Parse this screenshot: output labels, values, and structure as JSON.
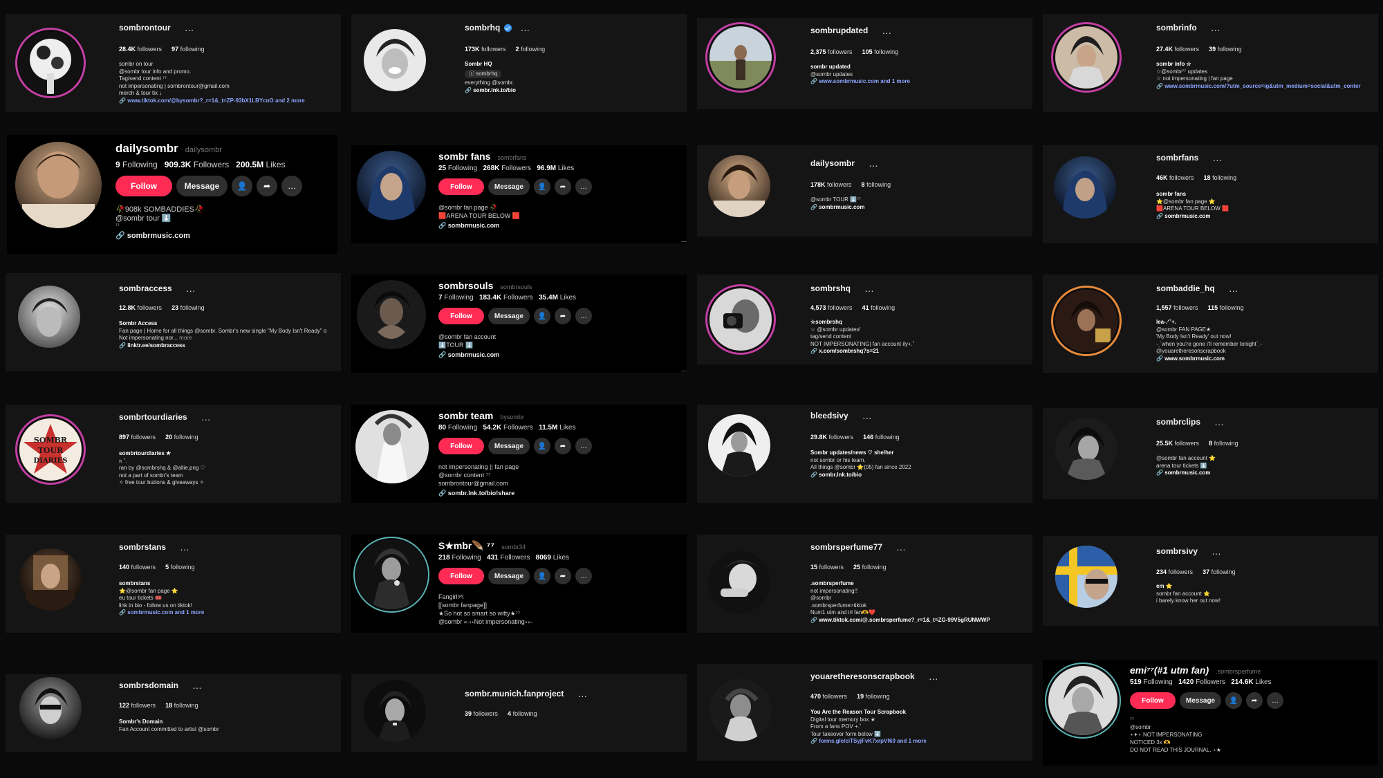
{
  "icons": {
    "more": "…",
    "add_user": "add-user-icon",
    "share": "share-icon",
    "link": "link-icon"
  },
  "colors": {
    "follow": "#fe2c55",
    "link": "#8da6ff",
    "story_ring": "#c23fa3",
    "verified": "#3897f0"
  },
  "ig": [
    {
      "user": "sombrontour",
      "followers": "28.4K",
      "following": "97",
      "bio": [
        "sombr on tour",
        "@sombr tour info and promo.",
        "Tag/send content ⁷⁷",
        "not impersonating | sombrontour@gmail.com",
        "merch & tour tix ↓"
      ],
      "link": "www.tiktok.com/@bysombr?_r=1&_t=ZP-93bX1LBYcnO and 2 more"
    },
    {
      "user": "sombrhq",
      "followers": "173K",
      "following": "2",
      "bio": [
        "Sombr HQ",
        "ⓢ sombrhq",
        "everything @sombr."
      ],
      "link": "sombr.lnk.to/bio"
    },
    {
      "user": "sombrupdated",
      "followers": "2,375",
      "following": "105",
      "bio": [
        "sombr updated",
        "@sombr updates"
      ],
      "link": "www.sombrmusic.com and 1 more"
    },
    {
      "user": "sombrinfo",
      "followers": "27.4K",
      "following": "39",
      "bio": [
        "sombr info ☆",
        "☆@sombr⁷⁷ updates",
        "☆ not impersonating | fan page"
      ],
      "link": "www.sombrmusic.com/?utm_source=ig&utm_medium=social&utm_conter"
    },
    {
      "user": "dailysombr",
      "followers": "178K",
      "following": "8",
      "bio": [
        "@sombr TOUR ⬇️⁷⁷"
      ],
      "link": "sombrmusic.com"
    },
    {
      "user": "sombrfans",
      "followers": "46K",
      "following": "18",
      "bio": [
        "sombr fans",
        "⭐@sombr fan page ⭐",
        "🟥ARENA TOUR BELOW 🟥"
      ],
      "link": "sombrmusic.com"
    },
    {
      "user": "sombraccess",
      "followers": "12.8K",
      "following": "23",
      "bio": [
        "Sombr Access",
        "Fan page | Home for all things @sombr. Sombr's new single \"My Body Isn't Ready\" o",
        "Not impersonating nor..."
      ],
      "more": "more",
      "link": "linktr.ee/sombraccess"
    },
    {
      "user": "sombrshq",
      "followers": "4,573",
      "following": "41",
      "bio": [
        "☆sombrshq",
        "☆ @sombr updates!",
        "tag/send content",
        "NOT IMPERSONATING| fan account ily+.˚"
      ],
      "link": "x.com/sombrshq?s=21"
    },
    {
      "user": "sombaddie_hq",
      "followers": "1,557",
      "following": "115",
      "bio": [
        "lea-.ᐟ˚+.",
        "@sombr FAN PAGE★",
        "'My Body Isn't Ready' out now!",
        "-ˏˋwhen you're gone i'll remember tonightˊˎ-",
        "@youaretheresonscrapbook"
      ],
      "link": "www.sombrmusic.com"
    },
    {
      "user": "sombrtourdiaries",
      "followers": "897",
      "following": "20",
      "bio": [
        "sombrtourdiaries ★",
        "೫ ˚.",
        "ran by @sombrshq & @allie.png ♡",
        "not a part of sombr's team",
        "✧ free tour buttons & giveaways ✧"
      ],
      "link": ""
    },
    {
      "user": "bleedsivy",
      "followers": "29.8K",
      "following": "146",
      "bio": [
        "Sombr updates/news ♡  she/her",
        "not sombr or his team.",
        "All things @sombr ⭐(05) fan since 2022"
      ],
      "link": "sombr.lnk.to/bio"
    },
    {
      "user": "sombrclips",
      "followers": "25.5K",
      "following": "8",
      "bio": [
        "@sombr fan account ⭐",
        "arena tour tickets ⬇️"
      ],
      "link": "sombrmusic.com"
    },
    {
      "user": "sombrstans",
      "followers": "140",
      "following": "5",
      "bio": [
        "sombrstans",
        "⭐@sombr fan page ⭐",
        "eu tour tickets 🎟️",
        "link in bio - follow us on tiktok!"
      ],
      "link": "sombrmusic.com and 1 more"
    },
    {
      "user": "sombrsperfume77",
      "followers": "15",
      "following": "25",
      "bio": [
        ".sombrsperfume",
        "not impersonating!!",
        "@sombr",
        ".sombrsperfume>tiktok",
        "Num1 utm and irl fan🫶❤️"
      ],
      "link": "www.tiktok.com/@.sombrsperfume?_r=1&_t=ZG-99V5gRUNWWP"
    },
    {
      "user": "sombrsivy",
      "followers": "234",
      "following": "37",
      "bio": [
        "em ⭐",
        "sombr fan account ⭐",
        "i barely know her out now!"
      ],
      "link": ""
    },
    {
      "user": "sombrsdomain",
      "followers": "122",
      "following": "18",
      "bio": [
        "Sombr's Domain",
        "Fan Account committed to artist @sombr"
      ],
      "link": ""
    },
    {
      "user": "sombr.munich.fanproject",
      "followers": "39",
      "following": "4",
      "bio": [],
      "link": ""
    },
    {
      "user": "youaretheresonscrapbook",
      "followers": "470",
      "following": "19",
      "bio": [
        "You Are the Reason Tour Scrapbook",
        "Digital tour memory box ★",
        "From a fans POV +.˚",
        "Tour takeover form below ⬇️"
      ],
      "link": "forms.gle/ciTSyjFvK7xrpVf69 and 1 more"
    }
  ],
  "tt": [
    {
      "name": "dailysombr",
      "handle": "dailysombr",
      "following": "9",
      "followers": "909.3K",
      "likes": "200.5M",
      "bio": [
        "🥀908k SOMBADDIES🥀",
        "@sombr tour ⬇️",
        "⁷⁷"
      ],
      "link": "sombrmusic.com"
    },
    {
      "name": "sombr fans",
      "handle": "sombrfans",
      "following": "25",
      "followers": "268K",
      "likes": "96.9M",
      "bio": [
        "@sombr fan page 🥀",
        "🟥ARENA TOUR BELOW 🟥"
      ],
      "link": "sombrmusic.com"
    },
    {
      "name": "sombrsouls",
      "handle": "sombrsouls",
      "following": "7",
      "followers": "183.4K",
      "likes": "35.4M",
      "bio": [
        "@sombr fan account",
        "⬇️TOUR ⬇️"
      ],
      "link": "sombrmusic.com"
    },
    {
      "name": "sombr team",
      "handle": "bysombr",
      "following": "80",
      "followers": "54.2K",
      "likes": "11.5M",
      "bio": [
        "not impersonating || fan page",
        "@sombr content ⁷⁷",
        "sombrontour@gmail.com"
      ],
      "link": "sombr.lnk.to/bio!share"
    },
    {
      "name": "S★mbr🪶 ⁷⁷",
      "handle": "sombr34",
      "following": "218",
      "followers": "431",
      "likes": "8069",
      "bio": [
        "Fangirl୨ৎ",
        "[[sombr fanpage]]",
        "★So hot so smart so witty★⁷⁷",
        "@sombr ⬷⋆Not impersonating⋆⬸"
      ],
      "link": ""
    },
    {
      "name": "emi⁷⁷(#1 utm fan)",
      "handle": ".sombrsperfume",
      "following": "519",
      "followers": "1420",
      "likes": "214.6K",
      "bio": [
        "⁷⁷",
        "@sombr",
        "⋆✦⋆ NOT IMPERSONATING",
        "NOTICED 3x 🫶",
        "DO NOT READ THIS JOURNAL. ⋆★"
      ],
      "link": ""
    }
  ],
  "labels": {
    "followers": "followers",
    "following": "following",
    "Following": "Following",
    "Followers": "Followers",
    "Likes": "Likes",
    "follow": "Follow",
    "message": "Message"
  }
}
